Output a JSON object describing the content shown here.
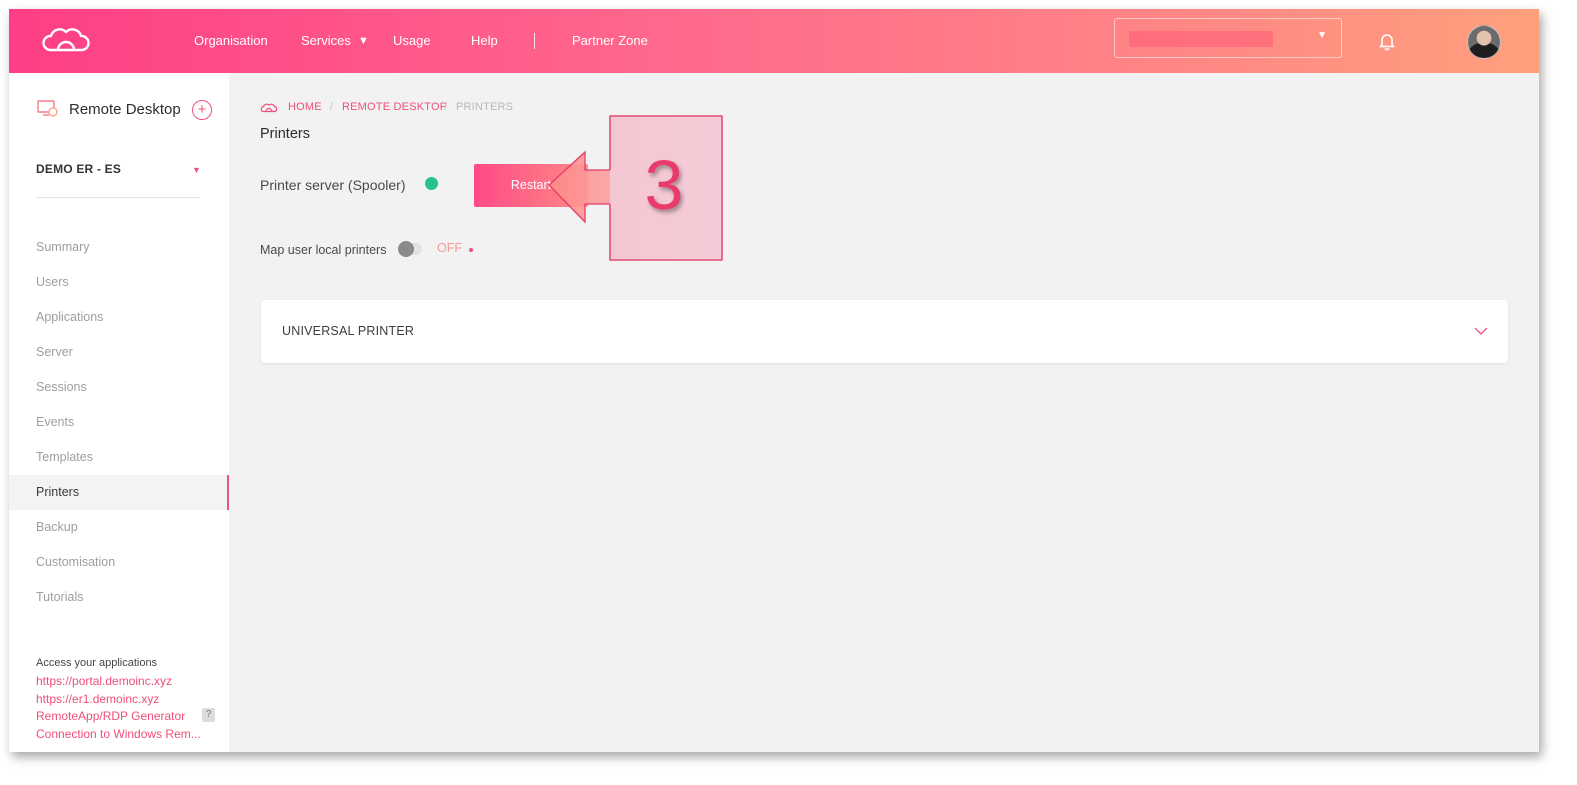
{
  "nav": {
    "items": [
      "Organisation",
      "Services",
      "Usage",
      "Help",
      "Partner Zone"
    ]
  },
  "sidebar": {
    "title": "Remote Desktop",
    "add_label": "+",
    "environment": "DEMO ER - ES",
    "menu": [
      "Summary",
      "Users",
      "Applications",
      "Server",
      "Sessions",
      "Events",
      "Templates",
      "Printers",
      "Backup",
      "Customisation",
      "Tutorials"
    ],
    "active_item": "Printers",
    "access_label": "Access your applications",
    "links": [
      "https://portal.demoinc.xyz",
      "https://er1.demoinc.xyz",
      "RemoteApp/RDP Generator",
      "Connection to Windows Rem..."
    ],
    "help_badge": "?"
  },
  "breadcrumb": [
    "HOME",
    "/",
    "REMOTE DESKTOP",
    "/",
    "PRINTERS"
  ],
  "page": {
    "title": "Printers",
    "spooler_label": "Printer server (Spooler)",
    "spooler_status": "running",
    "restart_label": "Restart",
    "map_printers_label": "Map user local printers",
    "map_printers_state": "OFF",
    "accordion_title": "UNIVERSAL PRINTER"
  },
  "annotation": {
    "step_number": "3"
  },
  "colors": {
    "accent": "#f0537d",
    "header_gradient_start": "#fe3e86",
    "header_gradient_end": "#ffa07c",
    "status_green": "#27c28a"
  }
}
